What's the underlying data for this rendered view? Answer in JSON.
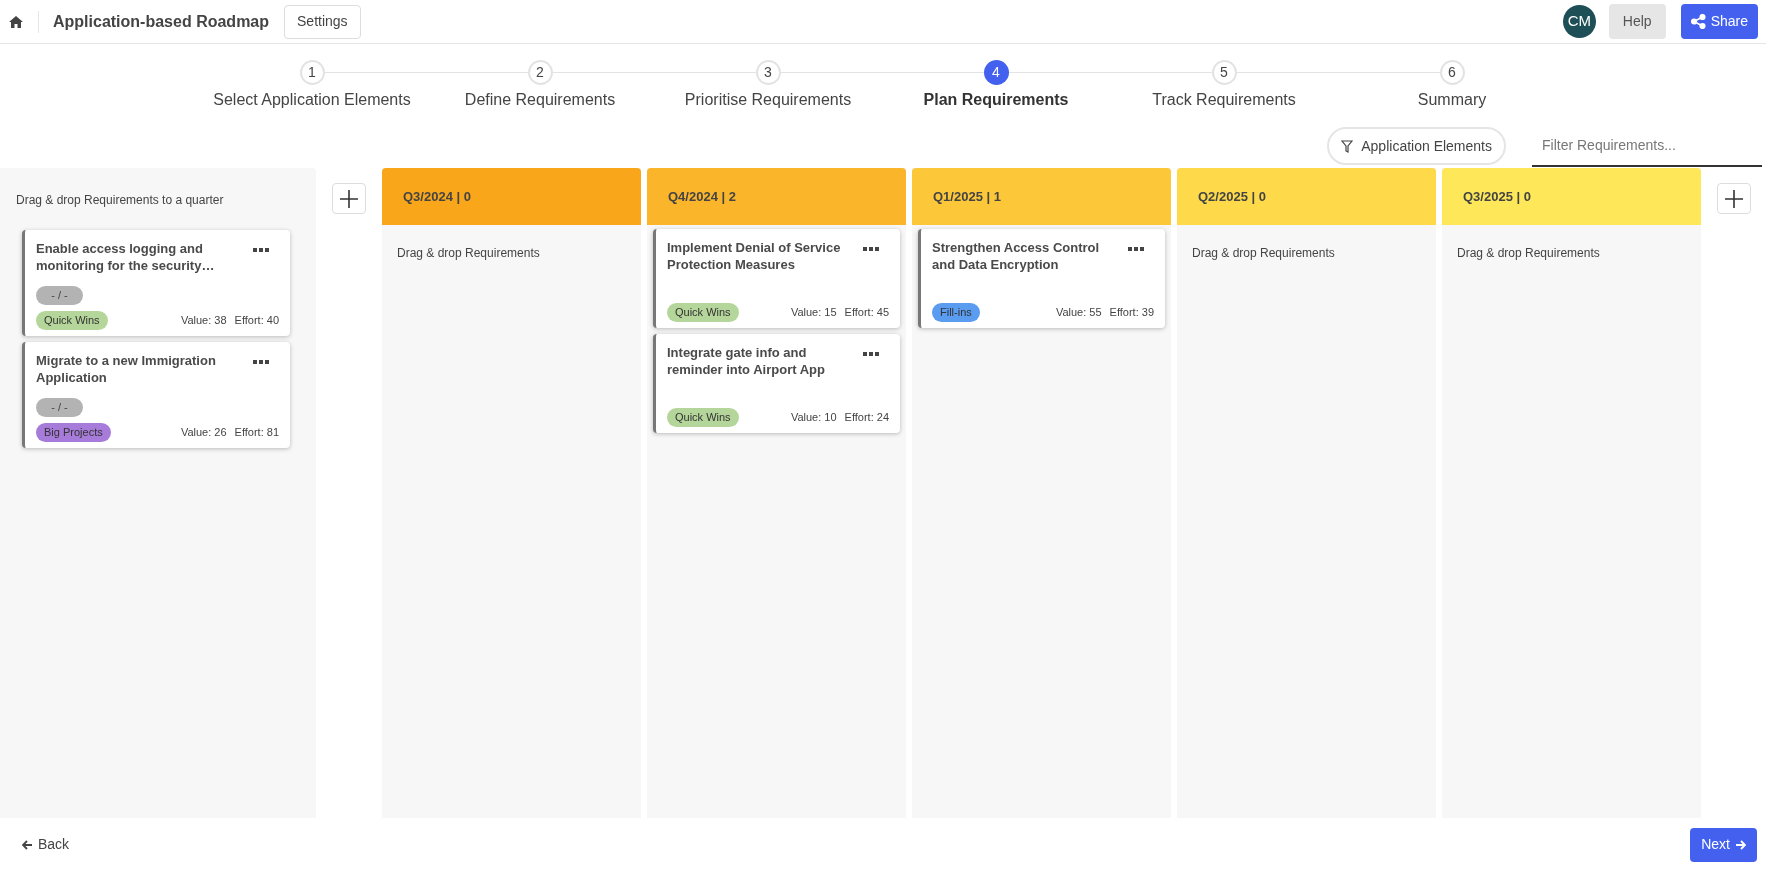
{
  "header": {
    "title": "Application-based Roadmap",
    "settings_button": "Settings",
    "avatar": "CM",
    "help_button": "Help",
    "share_button": "Share"
  },
  "steps": [
    {
      "number": "1",
      "label": "Select Application Elements",
      "selected": false
    },
    {
      "number": "2",
      "label": "Define Requirements",
      "selected": false
    },
    {
      "number": "3",
      "label": "Prioritise Requirements",
      "selected": false
    },
    {
      "number": "4",
      "label": "Plan Requirements",
      "selected": true
    },
    {
      "number": "5",
      "label": "Track Requirements",
      "selected": false
    },
    {
      "number": "6",
      "label": "Summary",
      "selected": false
    }
  ],
  "filter": {
    "chip": "Application Elements",
    "placeholder": "Filter Requirements..."
  },
  "backlog": {
    "hint": "Drag & drop Requirements to a quarter",
    "cards": [
      {
        "title": "Enable access logging and monitoring for the security…",
        "status": "- / -",
        "tag": "Quick Wins",
        "color": "#b5d69a",
        "value": "Value: 38",
        "effort": "Effort: 40"
      },
      {
        "title": "Migrate to a new Immigration Application",
        "status": "- / -",
        "tag": "Big Projects",
        "color": "#a67bd9",
        "value": "Value: 26",
        "effort": "Effort: 81"
      }
    ]
  },
  "quarters": [
    {
      "title": "Q3/2024 | 0",
      "color": "#faa61a",
      "empty_hint": "Drag & drop Requirements"
    },
    {
      "title": "Q4/2024 | 2",
      "color": "#fbb52b",
      "cards": [
        {
          "title": "Implement Denial of Service Protection Measures",
          "tag": "Quick Wins",
          "color": "#b5d69a",
          "value": "Value: 15",
          "effort": "Effort: 45"
        },
        {
          "title": "Integrate gate info and reminder into Airport App",
          "tag": "Quick Wins",
          "color": "#b5d69a",
          "value": "Value: 10",
          "effort": "Effort: 24"
        }
      ]
    },
    {
      "title": "Q1/2025 | 1",
      "color": "#fdc73a",
      "cards": [
        {
          "title": "Strengthen Access Control and Data Encryption",
          "tag": "Fill-ins",
          "color": "#5a9cf0",
          "value": "Value: 55",
          "effort": "Effort: 39"
        }
      ]
    },
    {
      "title": "Q2/2025 | 0",
      "color": "#fed94a",
      "empty_hint": "Drag & drop Requirements"
    },
    {
      "title": "Q3/2025 | 0",
      "color": "#fee85a",
      "empty_hint": "Drag & drop Requirements"
    }
  ],
  "footer": {
    "back": "Back",
    "next": "Next"
  }
}
